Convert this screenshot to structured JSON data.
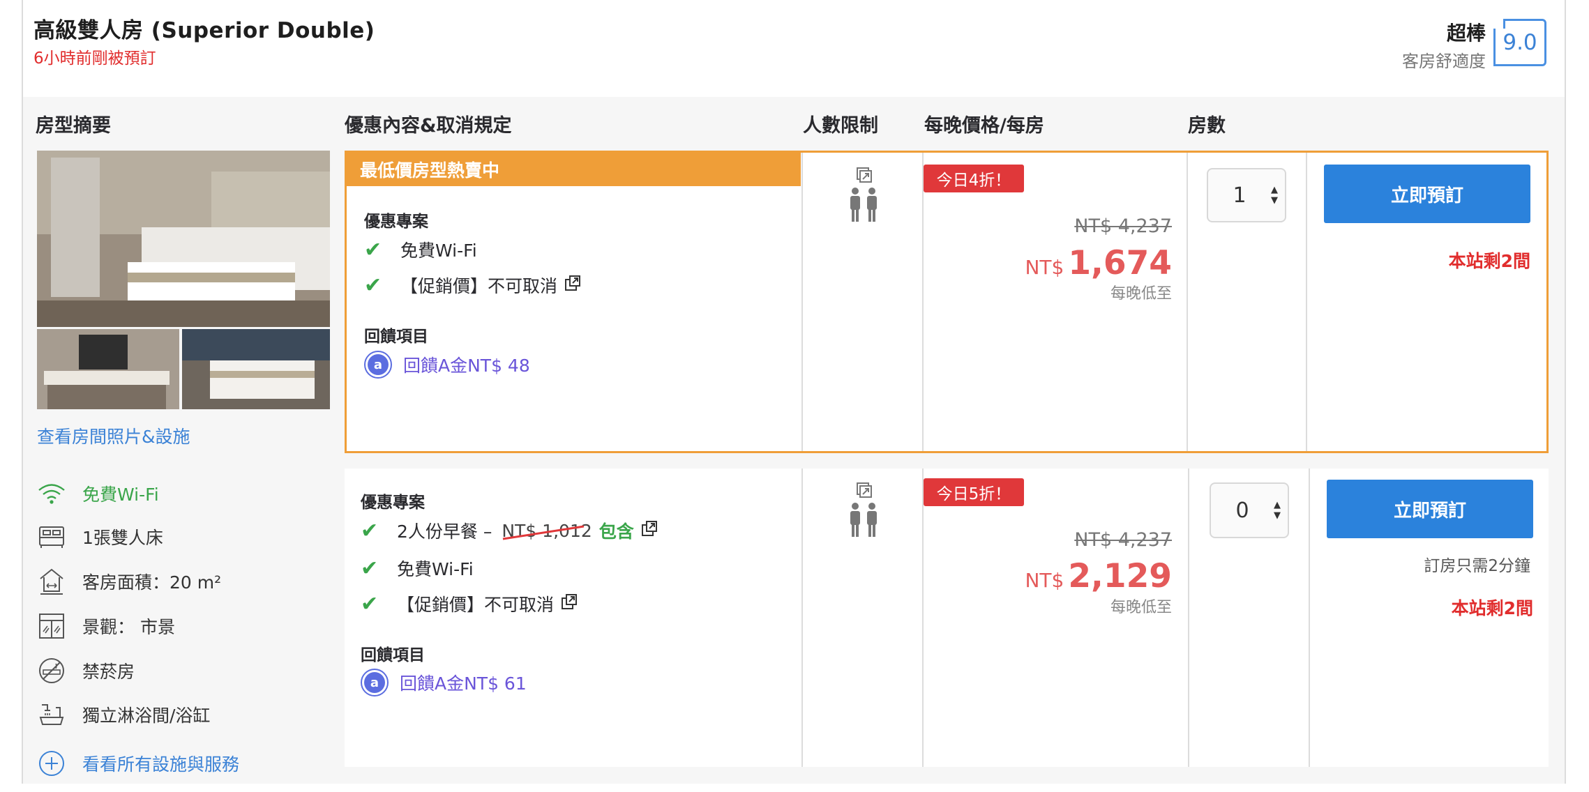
{
  "room": {
    "title": "高級雙人房 (Superior Double)",
    "recent_booking": "6小時前剛被預訂",
    "rating_word": "超棒",
    "rating_category": "客房舒適度",
    "rating_score": "9.0"
  },
  "columns": {
    "summary": "房型摘要",
    "offers": "優惠內容&取消規定",
    "occupancy": "人數限制",
    "price": "每晚價格/每房",
    "rooms": "房數"
  },
  "summary": {
    "photos_link": "查看房間照片&設施",
    "amenities": [
      {
        "icon": "wifi-icon",
        "label": "免費Wi-Fi",
        "highlight": true
      },
      {
        "icon": "bed-icon",
        "label": "1張雙人床"
      },
      {
        "icon": "room-size-icon",
        "label": "客房面積：20 m²"
      },
      {
        "icon": "window-view-icon",
        "label": "景觀： 市景"
      },
      {
        "icon": "no-smoking-icon",
        "label": "禁菸房"
      },
      {
        "icon": "shower-bath-icon",
        "label": "獨立淋浴間/浴缸"
      }
    ],
    "all_facilities_link": "看看所有設施與服務"
  },
  "offers": [
    {
      "banner": "最低價房型熱賣中",
      "perks_title": "優惠專案",
      "perks": [
        "免費Wi-Fi",
        "【促銷價】不可取消"
      ],
      "rewards_title": "回饋項目",
      "reward": "回饋A金NT$ 48",
      "discount_badge": "今日4折！",
      "old_price": "NT$ 4,237",
      "currency": "NT$",
      "price": "1,674",
      "per_night": "每晚低至",
      "rooms_selected": "1",
      "book_label": "立即預訂",
      "book_note": "",
      "rooms_left": "本站剩2間"
    },
    {
      "perks_title": "優惠專案",
      "breakfast_label": "2人份早餐 –",
      "breakfast_old_price": "NT$ 1,012",
      "breakfast_included": "包含",
      "perks": [
        "免費Wi-Fi",
        "【促銷價】不可取消"
      ],
      "rewards_title": "回饋項目",
      "reward": "回饋A金NT$ 61",
      "discount_badge": "今日5折！",
      "old_price": "NT$ 4,237",
      "currency": "NT$",
      "price": "2,129",
      "per_night": "每晚低至",
      "rooms_selected": "0",
      "book_label": "立即預訂",
      "book_note": "訂房只需2分鐘",
      "rooms_left": "本站剩2間"
    }
  ],
  "colors": {
    "accent_blue": "#2b82dc",
    "banner_orange": "#ef9e38",
    "price_red": "#e45a5a",
    "check_green": "#3aa54a",
    "reward_purple": "#6a55d9"
  }
}
